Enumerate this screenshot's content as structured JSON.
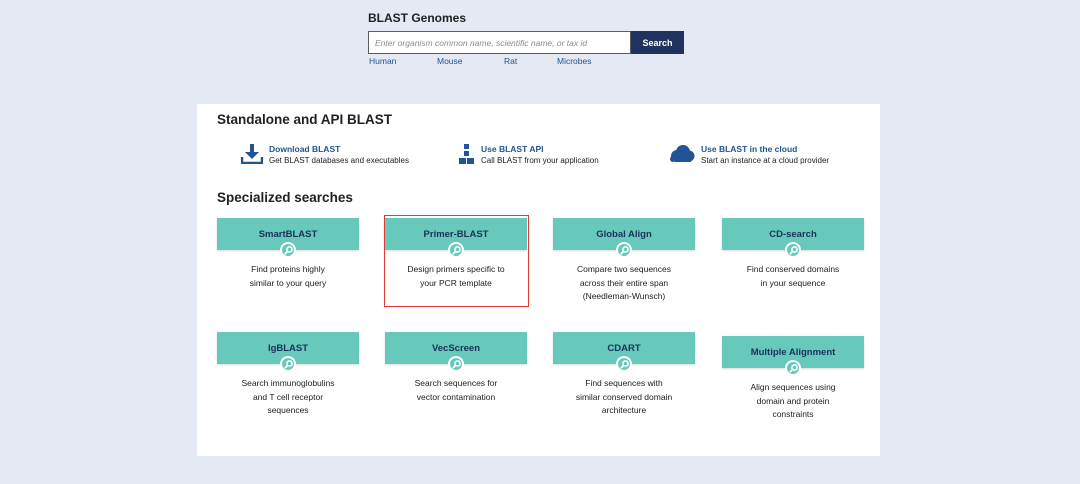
{
  "genomes": {
    "title": "BLAST Genomes",
    "search_placeholder": "Enter organism common name, scientific name, or tax id",
    "search_value": "",
    "search_button": "Search",
    "links": [
      "Human",
      "Mouse",
      "Rat",
      "Microbes"
    ]
  },
  "standalone": {
    "title": "Standalone and API BLAST",
    "items": [
      {
        "icon": "download-icon",
        "link": "Download BLAST",
        "desc": "Get BLAST databases and executables"
      },
      {
        "icon": "api-icon",
        "link": "Use BLAST API",
        "desc": "Call BLAST from your application"
      },
      {
        "icon": "cloud-icon",
        "link": "Use BLAST in the cloud",
        "desc": "Start an instance at a cloud provider"
      }
    ]
  },
  "specialized": {
    "title": "Specialized searches",
    "tiles": [
      {
        "name": "SmartBLAST",
        "desc": [
          "Find proteins highly",
          "similar to your query"
        ]
      },
      {
        "name": "Primer-BLAST",
        "desc": [
          "Design primers specific to",
          "your PCR template"
        ],
        "highlighted": true
      },
      {
        "name": "Global Align",
        "desc": [
          "Compare two sequences",
          "across their entire span",
          "(Needleman-Wunsch)"
        ]
      },
      {
        "name": "CD-search",
        "desc": [
          "Find conserved domains",
          "in your sequence"
        ]
      },
      {
        "name": "IgBLAST",
        "desc": [
          "Search immunoglobulins",
          "and T cell receptor",
          "sequences"
        ]
      },
      {
        "name": "VecScreen",
        "desc": [
          "Search sequences for",
          "vector contamination"
        ]
      },
      {
        "name": "CDART",
        "desc": [
          "Find sequences with",
          "similar conserved domain",
          "architecture"
        ]
      },
      {
        "name": "Multiple Alignment",
        "desc": [
          "Align sequences using",
          "domain and protein",
          "constraints"
        ]
      }
    ]
  },
  "colors": {
    "tile": "#66c9bb",
    "tile_text": "#1d2f5a",
    "link": "#205493",
    "button": "#20335e",
    "highlight": "#e53935",
    "background": "#e4e9f4"
  }
}
